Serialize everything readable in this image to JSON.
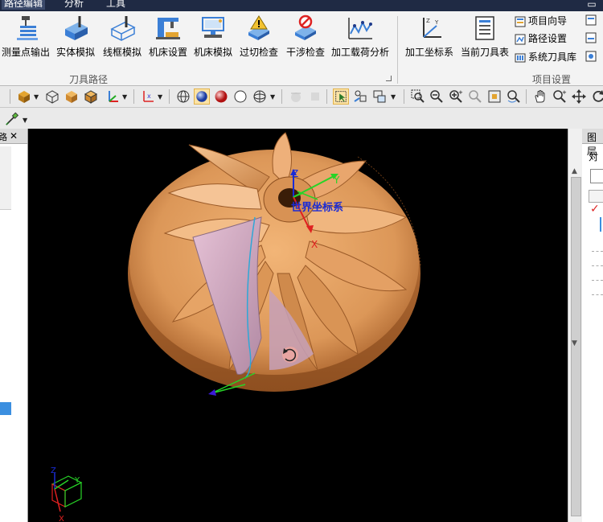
{
  "menubar": {
    "items": [
      "路径编辑",
      "分析",
      "工具"
    ],
    "window_button": "▭"
  },
  "ribbon": {
    "toolpath_group": {
      "label": "刀具路径",
      "buttons": [
        {
          "label": "测量点输出",
          "icon": "measure-point-output-icon"
        },
        {
          "label": "实体模拟",
          "icon": "solid-simulation-icon"
        },
        {
          "label": "线框模拟",
          "icon": "wireframe-simulation-icon"
        },
        {
          "label": "机床设置",
          "icon": "machine-setup-icon"
        },
        {
          "label": "机床模拟",
          "icon": "machine-simulation-icon"
        },
        {
          "label": "过切检查",
          "icon": "overcut-check-icon"
        },
        {
          "label": "干涉检查",
          "icon": "interference-check-icon"
        },
        {
          "label": "加工载荷分析",
          "icon": "machining-load-analysis-icon"
        }
      ]
    },
    "project_group": {
      "label": "项目设置",
      "buttons": [
        {
          "label": "加工坐标系",
          "icon": "machining-coordinate-icon"
        },
        {
          "label": "当前刀具表",
          "icon": "current-tool-table-icon"
        }
      ],
      "small_items": [
        {
          "label": "项目向导",
          "icon": "project-wizard-icon"
        },
        {
          "label": "路径设置",
          "icon": "path-settings-icon"
        },
        {
          "label": "系统刀具库",
          "icon": "system-tool-library-icon"
        }
      ]
    }
  },
  "viewport": {
    "world_cs_label": "世界坐标系",
    "axis_x": "X",
    "axis_y": "Y",
    "axis_z": "Z",
    "triad_x": "X",
    "triad_y": "Y",
    "triad_z": "Z"
  },
  "left_panel": {
    "title": "路",
    "close": "✕"
  },
  "right_panel": {
    "title": "图层",
    "row1": "对",
    "check": "✓"
  },
  "colors": {
    "impeller": "#e3a063",
    "impeller_dark": "#b86d35",
    "blade_highlight": "#d8b0c8",
    "viewport_bg": "#000000",
    "menubar_bg": "#1f2a44",
    "selection_blue": "#3b8fe0",
    "world_label": "#1a2bd6"
  }
}
